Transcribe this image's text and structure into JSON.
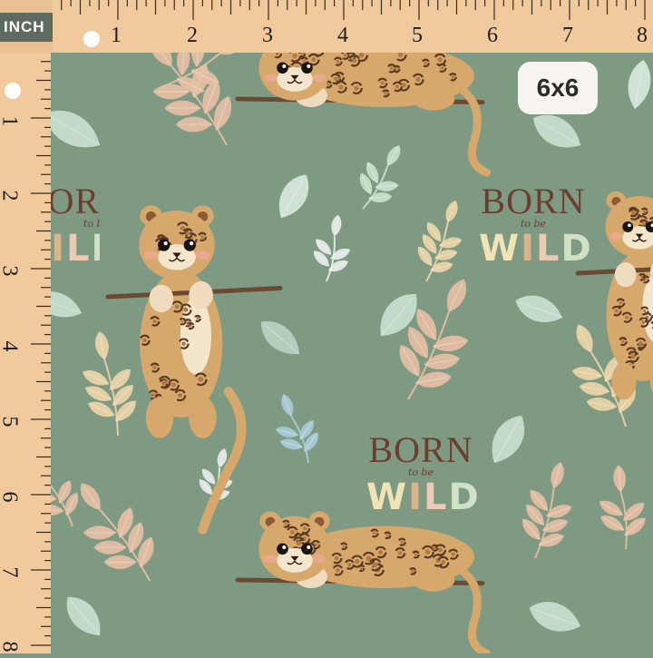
{
  "ruler": {
    "unit_label": "INCH",
    "top_numbers": [
      "1",
      "2",
      "3",
      "4",
      "5",
      "6",
      "7",
      "8"
    ],
    "left_numbers": [
      "1",
      "2",
      "3",
      "4",
      "5",
      "6",
      "7",
      "8"
    ]
  },
  "badge": {
    "text": "6x6"
  },
  "slogans": [
    {
      "line1": "BORN",
      "line2": "to be",
      "line3": [
        "W",
        "I",
        "L",
        "D"
      ]
    },
    {
      "line1": "BORN",
      "line2": "to be",
      "line3": [
        "W",
        "I",
        "L",
        "D"
      ]
    },
    {
      "line1": "BORN",
      "line2": "to be",
      "line3": [
        "W",
        "I",
        "L",
        "D"
      ]
    }
  ],
  "colors": {
    "fabric": "#7f9a82",
    "ruler_wood": "#f0c99d",
    "leopard_fur": "#d6a86c",
    "leopard_spot": "#5a3a22",
    "branch": "#6b4a34",
    "leaf_mint": "#c7dfcf",
    "leaf_peach": "#e6bfa5",
    "leaf_cream": "#ecd6a8"
  }
}
